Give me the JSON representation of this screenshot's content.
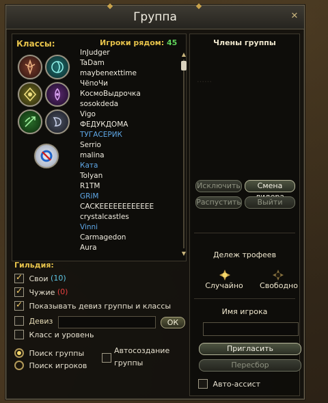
{
  "window": {
    "title": "Группа"
  },
  "left": {
    "classes_label": "Классы:",
    "nearby_label": "Игроки рядом:",
    "nearby_count": "45",
    "players": [
      {
        "name": "InJudger",
        "color": "white"
      },
      {
        "name": "TaDam",
        "color": "white"
      },
      {
        "name": "maybenexttime",
        "color": "white"
      },
      {
        "name": "ЧёпоЧи",
        "color": "white"
      },
      {
        "name": "КосмоВыдрочка",
        "color": "white"
      },
      {
        "name": "sosokdeda",
        "color": "white"
      },
      {
        "name": "Vigo",
        "color": "white"
      },
      {
        "name": "ФЕДУКДОМА",
        "color": "white"
      },
      {
        "name": "ТУГАСЕРИК",
        "color": "blue"
      },
      {
        "name": "Serrio",
        "color": "white"
      },
      {
        "name": "malina",
        "color": "white"
      },
      {
        "name": "Ката",
        "color": "blue"
      },
      {
        "name": "Tolyan",
        "color": "white"
      },
      {
        "name": "R1TM",
        "color": "white"
      },
      {
        "name": "GRiM",
        "color": "blue"
      },
      {
        "name": "CACKEEEEEEEEEEEE",
        "color": "white"
      },
      {
        "name": "crystalcastles",
        "color": "white"
      },
      {
        "name": "Vinni",
        "color": "blue"
      },
      {
        "name": "Carmagedon",
        "color": "white"
      },
      {
        "name": "Aura",
        "color": "white"
      }
    ]
  },
  "guild": {
    "label": "Гильдия:",
    "own_label": "Свои",
    "own_count": "(10)",
    "other_label": "Чужие",
    "other_count": "(0)"
  },
  "options": {
    "show_motto_label": "Показывать девиз группы и классы",
    "motto_label": "Девиз",
    "motto_value": "",
    "ok_label": "ОК",
    "class_level_label": "Класс и уровень",
    "search_group_label": "Поиск группы",
    "search_players_label": "Поиск игроков",
    "autocreate_label_1": "Автосоздание",
    "autocreate_label_2": "группы"
  },
  "right": {
    "members_header": "Члены группы",
    "kick_label": "Исключить",
    "change_leader_label": "Смена лидера",
    "disband_label": "Распустить",
    "leave_label": "Выйти",
    "loot_header": "Дележ трофеев",
    "random_label": "Случайно",
    "free_label": "Свободно",
    "player_name_header": "Имя игрока",
    "player_name_value": "",
    "invite_label": "Пригласить",
    "reselect_label": "Пересбор",
    "auto_assist_label": "Авто-ассист"
  },
  "colors": {
    "gold": "#e6c24a",
    "blue_name": "#5fa8e8",
    "count_green": "#5fd25a",
    "own_cyan": "#5fc8e8",
    "other_red": "#e84040"
  }
}
